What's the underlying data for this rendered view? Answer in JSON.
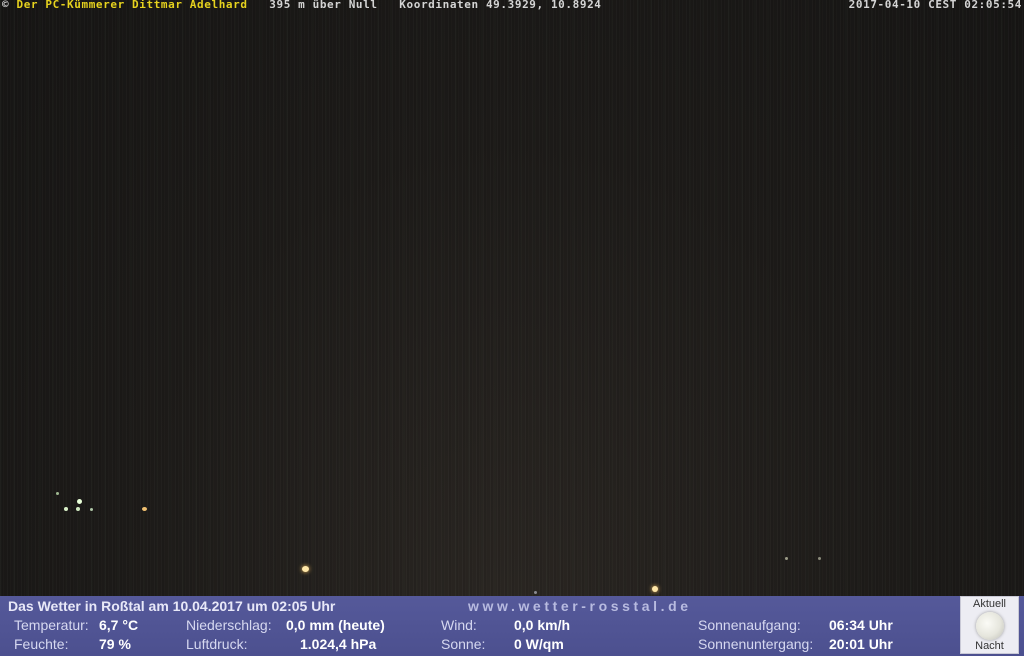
{
  "overlay": {
    "copyright": "©",
    "owner": "Der PC-Kümmerer Dittmar Adelhard",
    "altitude": "395 m über Null",
    "coordinates": "Koordinaten 49.3929, 10.8924",
    "timestamp": "2017-04-10 CEST 02:05:54"
  },
  "weather": {
    "title": "Das Wetter in Roßtal am 10.04.2017 um 02:05 Uhr",
    "site": "www.wetter-rosstal.de",
    "temperature_label": "Temperatur:",
    "temperature_value": "6,7 °C",
    "humidity_label": "Feuchte:",
    "humidity_value": "79 %",
    "precip_label": "Niederschlag:",
    "precip_value": "0,0 mm (heute)",
    "pressure_label": "Luftdruck:",
    "pressure_value": "1.024,4 hPa",
    "wind_label": "Wind:",
    "wind_value": "0,0 km/h",
    "sun_label": "Sonne:",
    "sun_value": "0 W/qm",
    "sunrise_label": "Sonnenaufgang:",
    "sunrise_value": "06:34 Uhr",
    "sunset_label": "Sonnenuntergang:",
    "sunset_value": "20:01 Uhr"
  },
  "moon": {
    "top_label": "Aktuell",
    "bottom_label": "Nacht",
    "icon": "moon-icon"
  }
}
